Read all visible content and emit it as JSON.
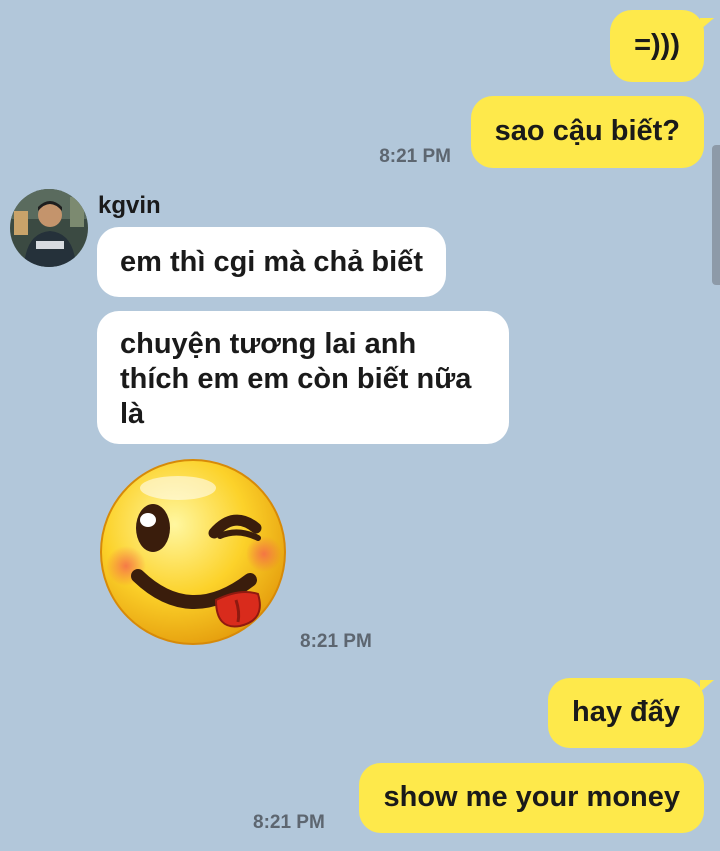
{
  "chat": {
    "messages": [
      {
        "sender": "me",
        "text": "=)))"
      },
      {
        "sender": "me",
        "text": "sao cậu biết?",
        "time": "8:21 PM"
      },
      {
        "sender": "kgvin",
        "name": "kgvin",
        "text": "em thì cgi mà chả biết"
      },
      {
        "sender": "kgvin",
        "text": "chuyện tương lai anh thích em em còn biết nữa là"
      },
      {
        "sender": "kgvin",
        "sticker": "winking-tongue-emoji",
        "time": "8:21 PM"
      },
      {
        "sender": "me",
        "text": "hay đấy"
      },
      {
        "sender": "me",
        "text": "show me your money",
        "time": "8:21 PM"
      }
    ]
  },
  "colors": {
    "background": "#b2c7da",
    "my_bubble": "#fee94b",
    "their_bubble": "#ffffff"
  }
}
